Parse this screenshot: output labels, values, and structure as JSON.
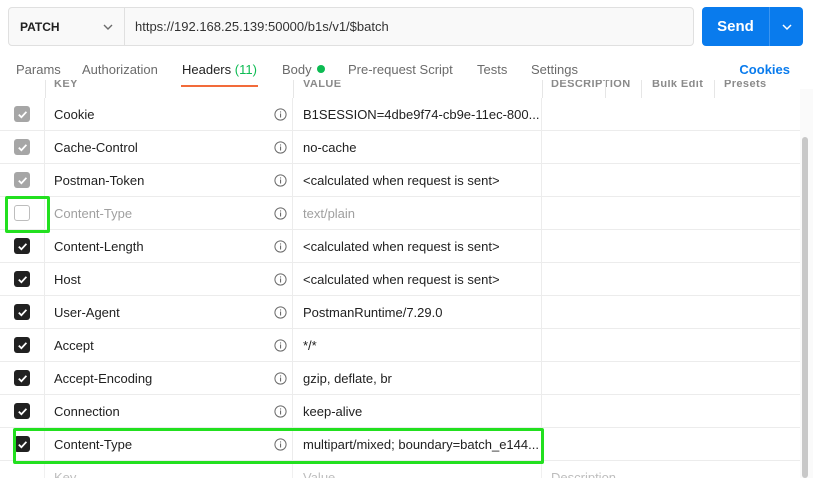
{
  "request": {
    "method": "PATCH",
    "url": "https://192.168.25.139:50000/b1s/v1/$batch",
    "send_label": "Send"
  },
  "tabs": [
    {
      "label": "Params"
    },
    {
      "label": "Authorization"
    },
    {
      "label": "Headers",
      "count": "(11)"
    },
    {
      "label": "Body"
    },
    {
      "label": "Pre-request Script"
    },
    {
      "label": "Tests"
    },
    {
      "label": "Settings"
    }
  ],
  "cookies_label": "Cookies",
  "table": {
    "headers": [
      "KEY",
      "VALUE",
      "DESCRIPTION",
      "Bulk Edit",
      "Presets"
    ],
    "rows": [
      {
        "key": "Cookie",
        "value": "B1SESSION=4dbe9f74-cb9e-11ec-800...",
        "checkbox": "gray"
      },
      {
        "key": "Cache-Control",
        "value": "no-cache",
        "checkbox": "gray"
      },
      {
        "key": "Postman-Token",
        "value": "<calculated when request is sent>",
        "checkbox": "gray"
      },
      {
        "key": "Content-Type",
        "value": "text/plain",
        "checkbox": "empty"
      },
      {
        "key": "Content-Length",
        "value": "<calculated when request is sent>",
        "checkbox": "checked"
      },
      {
        "key": "Host",
        "value": "<calculated when request is sent>",
        "checkbox": "checked"
      },
      {
        "key": "User-Agent",
        "value": "PostmanRuntime/7.29.0",
        "checkbox": "checked"
      },
      {
        "key": "Accept",
        "value": "*/*",
        "checkbox": "checked"
      },
      {
        "key": "Accept-Encoding",
        "value": "gzip, deflate, br",
        "checkbox": "checked"
      },
      {
        "key": "Connection",
        "value": "keep-alive",
        "checkbox": "checked"
      },
      {
        "key": "Content-Type",
        "value": "multipart/mixed; boundary=batch_e144...",
        "checkbox": "checked"
      }
    ],
    "new_row": {
      "key_placeholder": "Key",
      "value_placeholder": "Value",
      "description_placeholder": "Description"
    }
  },
  "colors": {
    "send": "#097bed",
    "active_tab_underline": "#f26b3a",
    "count": "#0cbb52",
    "highlight": "#22e01f"
  }
}
